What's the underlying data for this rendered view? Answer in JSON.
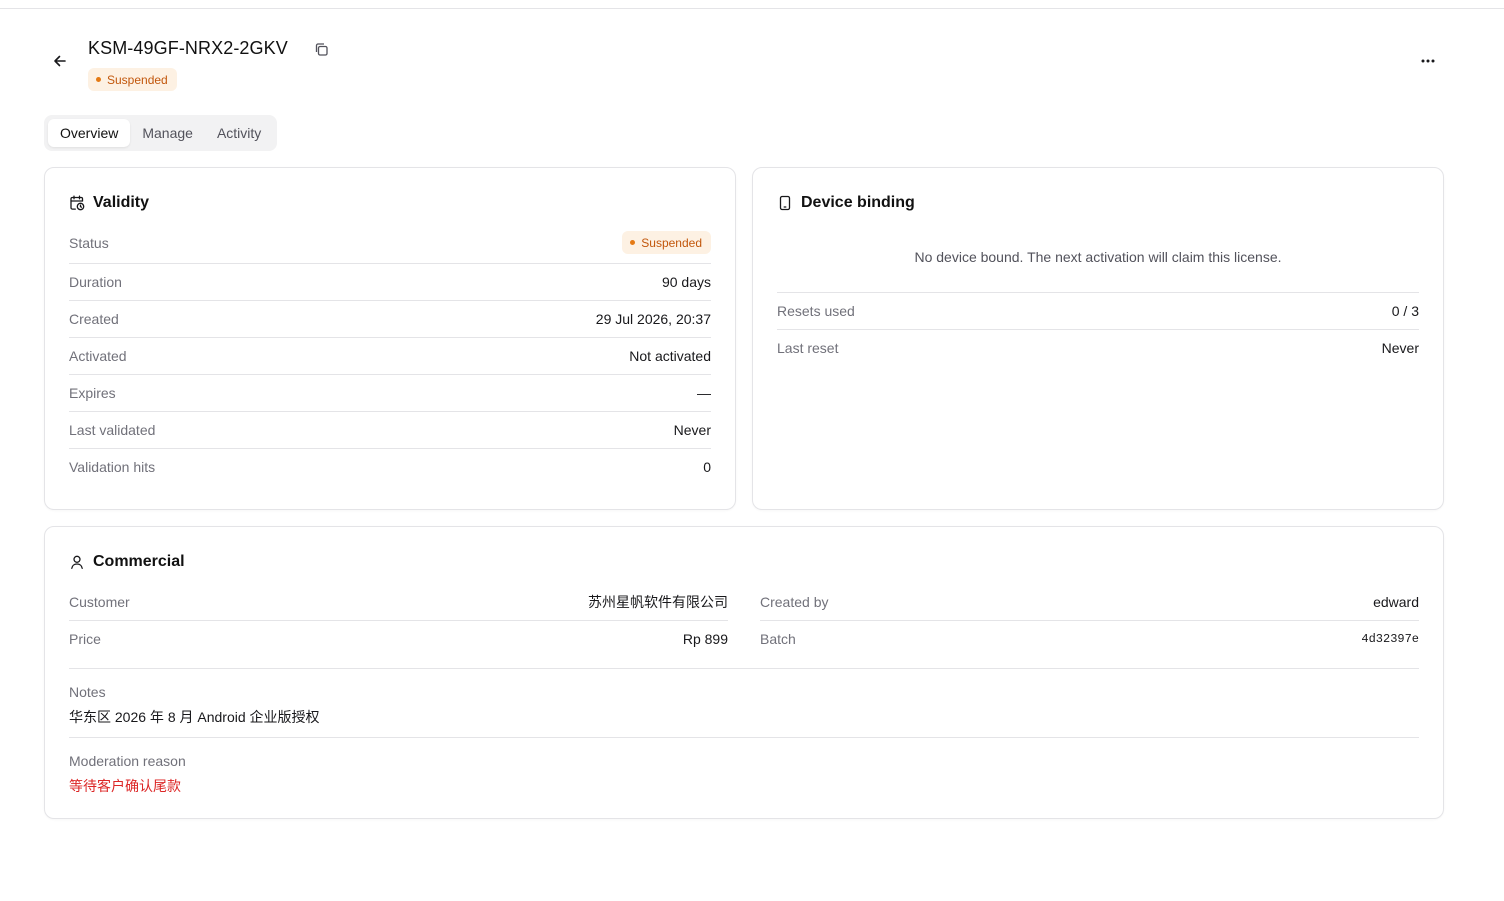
{
  "license": {
    "key": "KSM-49GF-NRX2-2GKV",
    "status": "Suspended"
  },
  "colors": {
    "badge_bg": "#fdf1e3",
    "badge_text": "#c2570c",
    "badge_dot": "#e57a14",
    "danger_text": "#dc2626",
    "border": "#e4e4e7"
  },
  "icons": {
    "back": "arrow-left-icon",
    "copy": "copy-icon",
    "more": "more-horizontal-icon",
    "validity": "calendar-clock-icon",
    "device": "smartphone-icon",
    "commercial": "user-icon"
  },
  "tabs": [
    {
      "label": "Overview",
      "active": true
    },
    {
      "label": "Manage",
      "active": false
    },
    {
      "label": "Activity",
      "active": false
    }
  ],
  "validity": {
    "title": "Validity",
    "rows": [
      {
        "label": "Status",
        "value": "Suspended"
      },
      {
        "label": "Duration",
        "value": "90 days"
      },
      {
        "label": "Created",
        "value": "29 Jul 2026, 20:37"
      },
      {
        "label": "Activated",
        "value": "Not activated"
      },
      {
        "label": "Expires",
        "value": "—"
      },
      {
        "label": "Last validated",
        "value": "Never"
      },
      {
        "label": "Validation hits",
        "value": "0"
      }
    ]
  },
  "device": {
    "title": "Device binding",
    "empty_message": "No device bound. The next activation will claim this license.",
    "rows": [
      {
        "label": "Resets used",
        "value": "0 / 3"
      },
      {
        "label": "Last reset",
        "value": "Never"
      }
    ]
  },
  "commercial": {
    "title": "Commercial",
    "left_rows": [
      {
        "label": "Customer",
        "value": "苏州星帆软件有限公司"
      },
      {
        "label": "Price",
        "value": "Rp 899"
      }
    ],
    "right_rows": [
      {
        "label": "Created by",
        "value": "edward"
      },
      {
        "label": "Batch",
        "value": "4d32397e"
      }
    ],
    "notes_label": "Notes",
    "notes_value": "华东区 2026 年 8 月 Android 企业版授权",
    "moderation_label": "Moderation reason",
    "moderation_value": "等待客户确认尾款"
  }
}
